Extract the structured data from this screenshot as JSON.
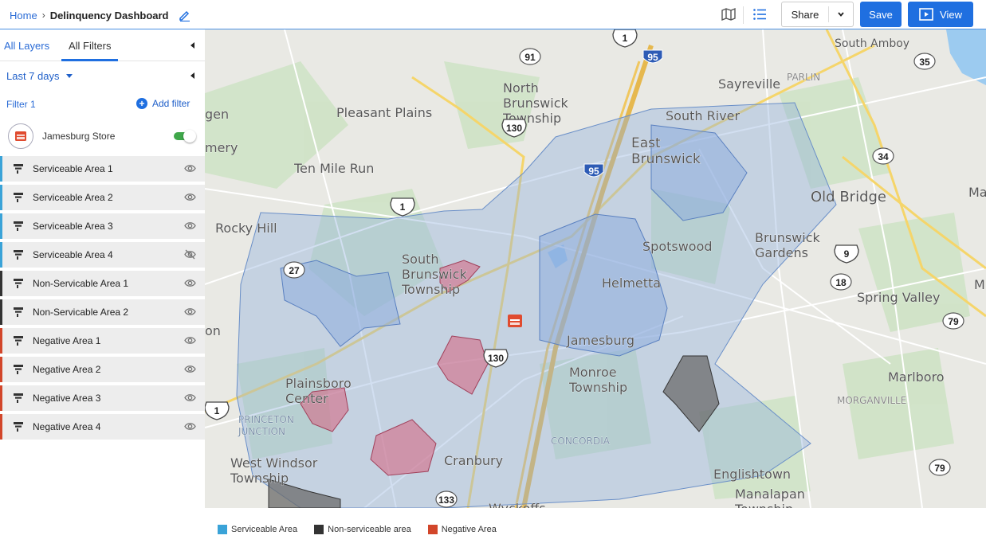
{
  "breadcrumb": {
    "home": "Home",
    "separator": "›",
    "title": "Delinquency Dashboard",
    "edit_icon": "pencil-icon"
  },
  "toolbar": {
    "map_icon": "map-icon",
    "list_icon": "list-icon",
    "share_label": "Share",
    "save_label": "Save",
    "view_label": "View"
  },
  "sidebar": {
    "tabs": [
      {
        "label": "All Layers"
      },
      {
        "label": "All Filters",
        "active": true
      }
    ],
    "date_range": "Last 7 days",
    "filter_label": "Filter 1",
    "add_filter_label": "Add filter",
    "store": {
      "name": "Jamesburg Store",
      "enabled": true
    },
    "layers": [
      {
        "label": "Serviceable Area 1",
        "type": "serviceable",
        "visible": true
      },
      {
        "label": "Serviceable Area 2",
        "type": "serviceable",
        "visible": true
      },
      {
        "label": "Serviceable Area 3",
        "type": "serviceable",
        "visible": true
      },
      {
        "label": "Serviceable Area 4",
        "type": "serviceable",
        "visible": false
      },
      {
        "label": "Non-Servicable Area 1",
        "type": "non-serviceable",
        "visible": true
      },
      {
        "label": "Non-Servicable Area 2",
        "type": "non-serviceable",
        "visible": true
      },
      {
        "label": "Negative Area 1",
        "type": "negative",
        "visible": true
      },
      {
        "label": "Negative Area 2",
        "type": "negative",
        "visible": true
      },
      {
        "label": "Negative Area 3",
        "type": "negative",
        "visible": true
      },
      {
        "label": "Negative Area 4",
        "type": "negative",
        "visible": true
      }
    ]
  },
  "colors": {
    "accent": "#1f6fe0",
    "serviceable": "#3aa3d8",
    "non_serviceable": "#333333",
    "negative": "#d2462a"
  },
  "map": {
    "places": [
      "South Amboy",
      "PARLIN",
      "Sayreville",
      "North Brunswick Township",
      "Pleasant Plains",
      "South River",
      "gen",
      "mery",
      "East Brunswick",
      "Ten Mile Run",
      "Old Bridge",
      "Mat",
      "Rocky Hill",
      "Brunswick Gardens",
      "Spotswood",
      "South Brunswick Township",
      "Helmetta",
      "Spring Valley",
      "M",
      "on",
      "Jamesburg",
      "Monroe Township",
      "Marlboro",
      "Plainsboro Center",
      "MORGANVILLE",
      "PRINCETON JUNCTION",
      "CONCORDIA",
      "West Windsor Township",
      "Cranbury",
      "Englishtown",
      "Manalapan Township",
      "Wyckoffs Mill"
    ],
    "shields": [
      "1",
      "91",
      "95",
      "35",
      "130",
      "34",
      "95",
      "1",
      "9",
      "27",
      "18",
      "130",
      "79",
      "1",
      "79",
      "133"
    ]
  },
  "legend": [
    {
      "label": "Serviceable Area",
      "color": "#3aa3d8"
    },
    {
      "label": "Non-serviceable area",
      "color": "#333333"
    },
    {
      "label": "Negative Area",
      "color": "#d2462a"
    }
  ]
}
